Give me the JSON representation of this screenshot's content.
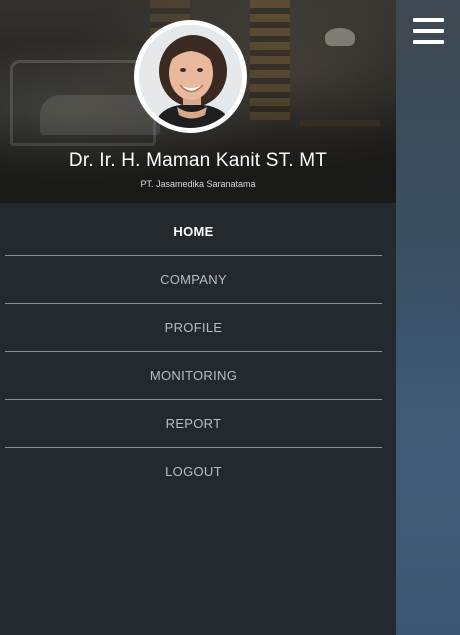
{
  "menu_button": {
    "icon": "hamburger-menu-icon"
  },
  "profile": {
    "name": "Dr. Ir. H. Maman Kanit ST. MT",
    "company": "PT. Jasamedika Saranatama",
    "avatar_icon": "user-avatar"
  },
  "nav": {
    "items": [
      {
        "label": "HOME",
        "active": true
      },
      {
        "label": "COMPANY",
        "active": false
      },
      {
        "label": "PROFILE",
        "active": false
      },
      {
        "label": "MONITORING",
        "active": false
      },
      {
        "label": "REPORT",
        "active": false
      },
      {
        "label": "LOGOUT",
        "active": false
      }
    ]
  },
  "colors": {
    "drawer_bg": "#23292d",
    "divider": "#8a8f93",
    "nav_text": "#b9bdc0",
    "active_text": "#ffffff",
    "backdrop": "#3b5773"
  }
}
